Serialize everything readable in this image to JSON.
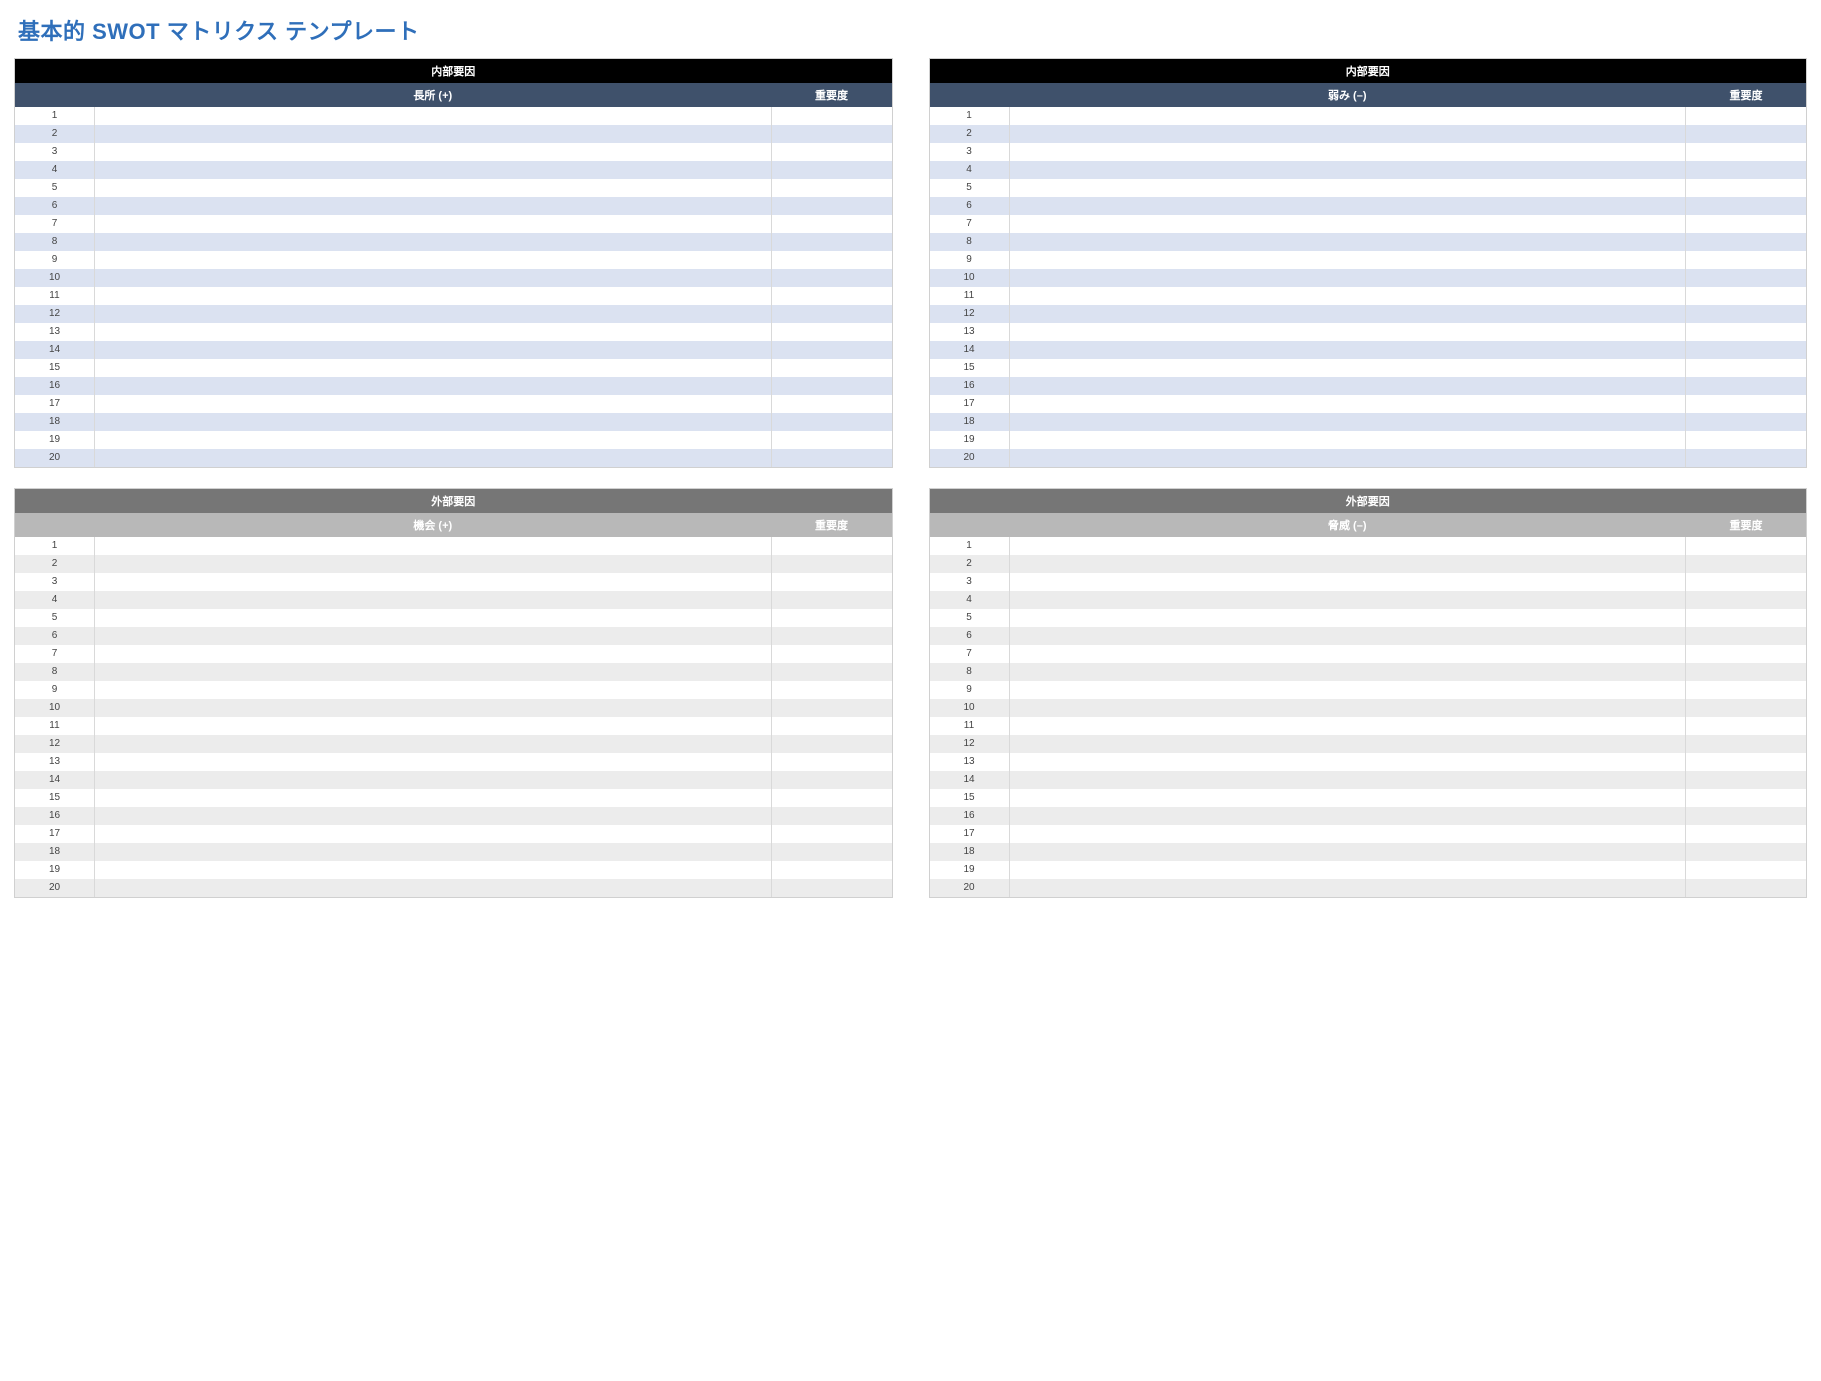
{
  "title": "基本的 SWOT マトリクス テンプレート",
  "importance_header": "重要度",
  "row_count": 20,
  "quadrants": [
    {
      "key": "strengths",
      "section_type": "internal",
      "section_label": "内部要因",
      "column_label": "長所 (+)"
    },
    {
      "key": "weaknesses",
      "section_type": "internal",
      "section_label": "内部要因",
      "column_label": "弱み (–)"
    },
    {
      "key": "opportunities",
      "section_type": "external",
      "section_label": "外部要因",
      "column_label": "機会 (+)"
    },
    {
      "key": "threats",
      "section_type": "external",
      "section_label": "外部要因",
      "column_label": "脅威 (–)"
    }
  ]
}
